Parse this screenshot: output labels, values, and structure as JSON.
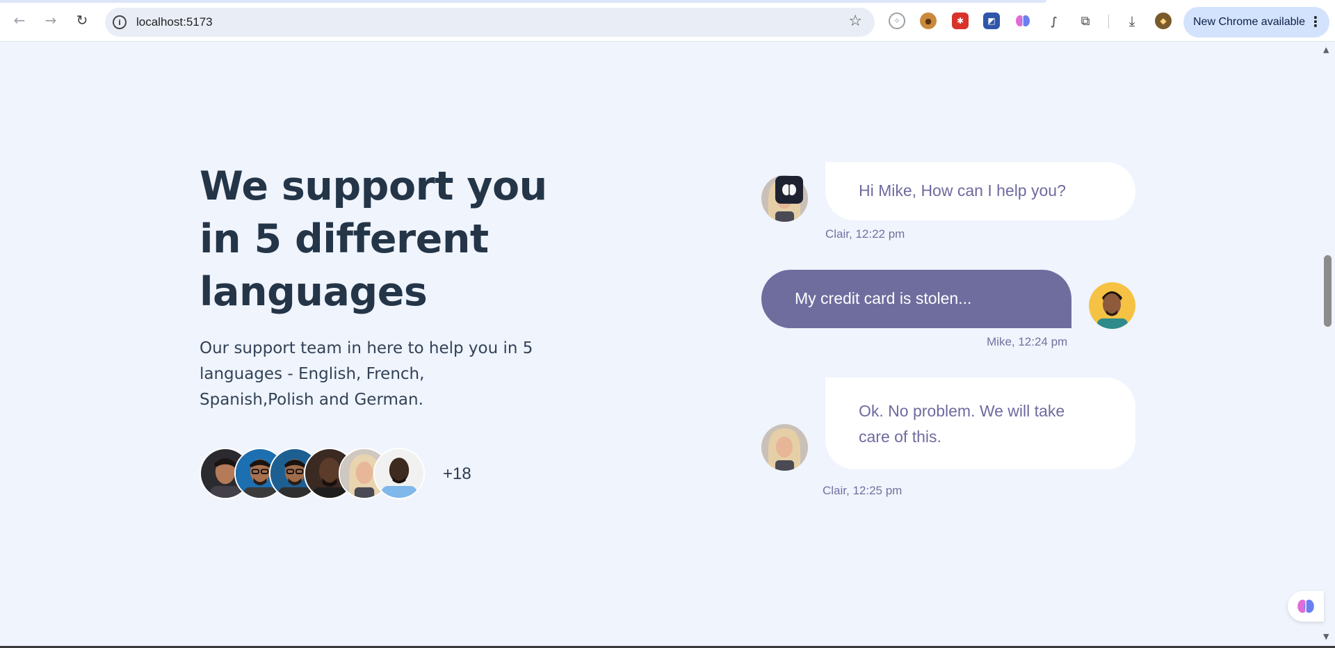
{
  "browser": {
    "url": "localhost:5173",
    "update_button_label": "New Chrome available",
    "extensions": [
      "compass-icon",
      "cookie-icon",
      "monster-icon",
      "puzzle-tile-icon",
      "brain-icon",
      "feather-icon",
      "extensions-puzzle-icon"
    ]
  },
  "hero": {
    "heading_lines": [
      "We support you",
      "in 5 different",
      "languages"
    ],
    "body_lines": [
      "Our support team in here to help you in 5",
      "languages - English, French,",
      "Spanish,Polish and German."
    ],
    "team_extra_count": "+18"
  },
  "chat": {
    "messages": [
      {
        "from": "agent",
        "text_lines": [
          "Hi Mike, How can I help you?"
        ],
        "meta": "Clair, 12:22 pm"
      },
      {
        "from": "customer",
        "text_lines": [
          "My credit card is stolen..."
        ],
        "meta": "Mike, 12:24 pm"
      },
      {
        "from": "agent",
        "text_lines": [
          "Ok. No problem. We will take",
          "care of this."
        ],
        "meta": "Clair, 12:25 pm"
      }
    ]
  },
  "colors": {
    "page_bg": "#eff4fd",
    "heading": "#243548",
    "agent_bubble": "#ffffff",
    "customer_bubble": "#6f6c9e",
    "agent_text": "#6e6a9f"
  }
}
